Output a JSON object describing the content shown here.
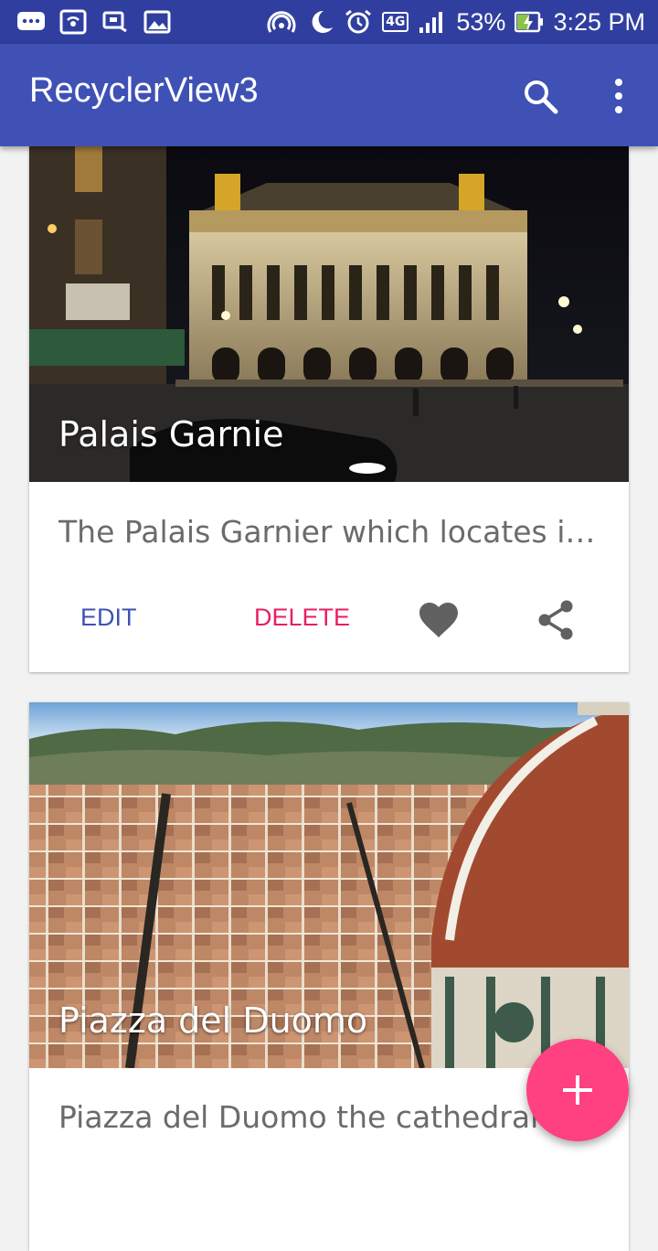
{
  "status_bar": {
    "battery": "53%",
    "time": "3:25 PM",
    "network": "4G"
  },
  "app_bar": {
    "title": "RecyclerView3",
    "icons": [
      "search-icon",
      "more-vert-icon"
    ]
  },
  "cards": [
    {
      "title": "Palais Garnie",
      "description": "The Palais Garnier which locates in Paris",
      "edit_label": "EDIT",
      "delete_label": "DELETE"
    },
    {
      "title": "Piazza del Duomo",
      "description": "Piazza del Duomo the cathedral w"
    }
  ],
  "colors": {
    "primary": "#3f51b5",
    "primary_dark": "#303f9f",
    "accent": "#ff4081",
    "delete": "#e91e63"
  }
}
